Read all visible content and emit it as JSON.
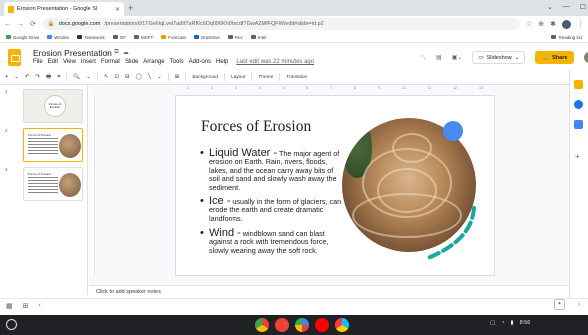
{
  "browser": {
    "tab_title": "Erosion Presentation - Google Sl",
    "tab_close": "✕",
    "new_tab": "+",
    "url_domain": "docs.google.com",
    "url_rest": "/presentation/d/1TGeNqLvel7adIf7aRf6c6Dq096Kh0txcdf7GwA2MfFQFW/edit#slide=id.p2",
    "window_controls": [
      "⌄",
      "—",
      "☐"
    ],
    "colors": {
      "tabbar": "#dee1e6",
      "accent": "#f4b400"
    }
  },
  "bookmarks": {
    "items": [
      "Google Drive",
      "Windex",
      "Teamwork",
      "GF",
      "MSFT",
      "Forecast",
      "OneDrive",
      "Rec",
      "Intel"
    ],
    "right": "Reading list"
  },
  "app": {
    "title": "Erosion Presentation",
    "title_icons": [
      "☆",
      "⧉",
      "☁"
    ],
    "menu": [
      "File",
      "Edit",
      "View",
      "Insert",
      "Format",
      "Slide",
      "Arrange",
      "Tools",
      "Add-ons",
      "Help"
    ],
    "last_edit": "Last edit was 22 minutes ago",
    "slideshow_label": "Slideshow",
    "share_label": "Share"
  },
  "toolbar": {
    "items": [
      "+",
      "⌄",
      "↶",
      "↷",
      "🖶",
      "⌗",
      "🔍",
      "⌄",
      "↖",
      "⊡",
      "⊟",
      "◯",
      "╲",
      "⌄",
      "⊞"
    ],
    "background_label": "Background",
    "layout_label": "Layout",
    "theme_label": "Theme",
    "transition_label": "Transition",
    "collapse": "^"
  },
  "filmstrip": {
    "slides": [
      {
        "num": "1",
        "title": "Forces of Erosion"
      },
      {
        "num": "2",
        "title": "Forces of Erosion"
      },
      {
        "num": "3",
        "title": "Forces of Erosion"
      }
    ]
  },
  "ruler": {
    "ticks": [
      "1",
      "2",
      "3",
      "4",
      "5",
      "6",
      "7",
      "8",
      "9",
      "10",
      "11",
      "12",
      "13"
    ]
  },
  "slide": {
    "title": "Forces of Erosion",
    "bullets": [
      {
        "lead": "Liquid Water -",
        "rest": "The major agent of erosion on Earth. Rain, rivers, floods, lakes, and the ocean carry away bits of soil and sand and slowly wash away the sediment."
      },
      {
        "lead": "Ice -",
        "rest": "usually in the form of glaciers, can erode the earth and create dramatic landforms."
      },
      {
        "lead": "Wind -",
        "rest": "windblown sand can blast against a rock with tremendous force, slowly wearing away the soft rock."
      }
    ],
    "bullet_glyph": "•",
    "colors": {
      "blue_dot": "#4a8af0",
      "teal_arc": "#1ba8a0"
    }
  },
  "notes": {
    "placeholder": "Click to add speaker notes"
  },
  "bottom": {
    "left_icons": [
      "▦",
      "⊞",
      "‹"
    ],
    "right_icon": "›"
  },
  "shelf": {
    "tray_text": "8:56",
    "dock": [
      "chrome",
      "gmail",
      "photos",
      "youtube",
      "play"
    ]
  }
}
